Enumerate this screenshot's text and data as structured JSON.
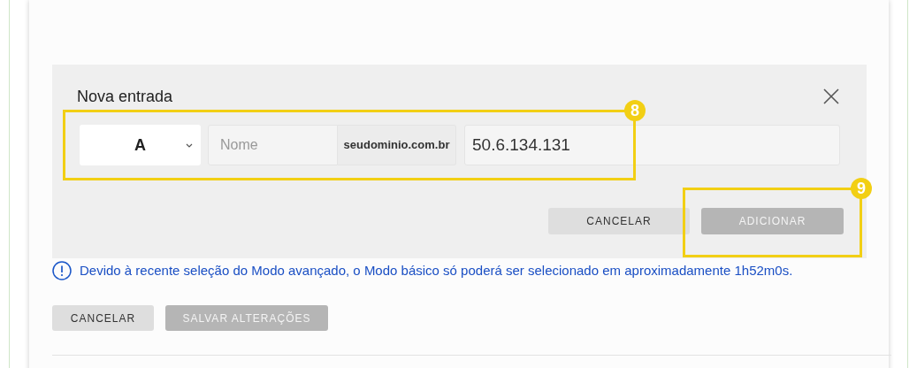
{
  "dialog": {
    "title": "Nova entrada",
    "record_type": "A",
    "name_placeholder": "Nome",
    "domain": "seudominio.com.br",
    "value": "50.6.134.131",
    "buttons": [
      {
        "label": "CANCELAR",
        "disabled": false
      },
      {
        "label": "ADICIONAR",
        "disabled": true
      }
    ]
  },
  "notice": "Devido à recente seleção do Modo avançado, o Modo básico só poderá ser selecionado em aproximadamente 1h52m0s.",
  "footer_buttons": [
    {
      "label": "CANCELAR",
      "disabled": false
    },
    {
      "label": "SALVAR ALTERAÇÕES",
      "disabled": true
    }
  ],
  "callouts": [
    {
      "label": "8"
    },
    {
      "label": "9"
    }
  ]
}
